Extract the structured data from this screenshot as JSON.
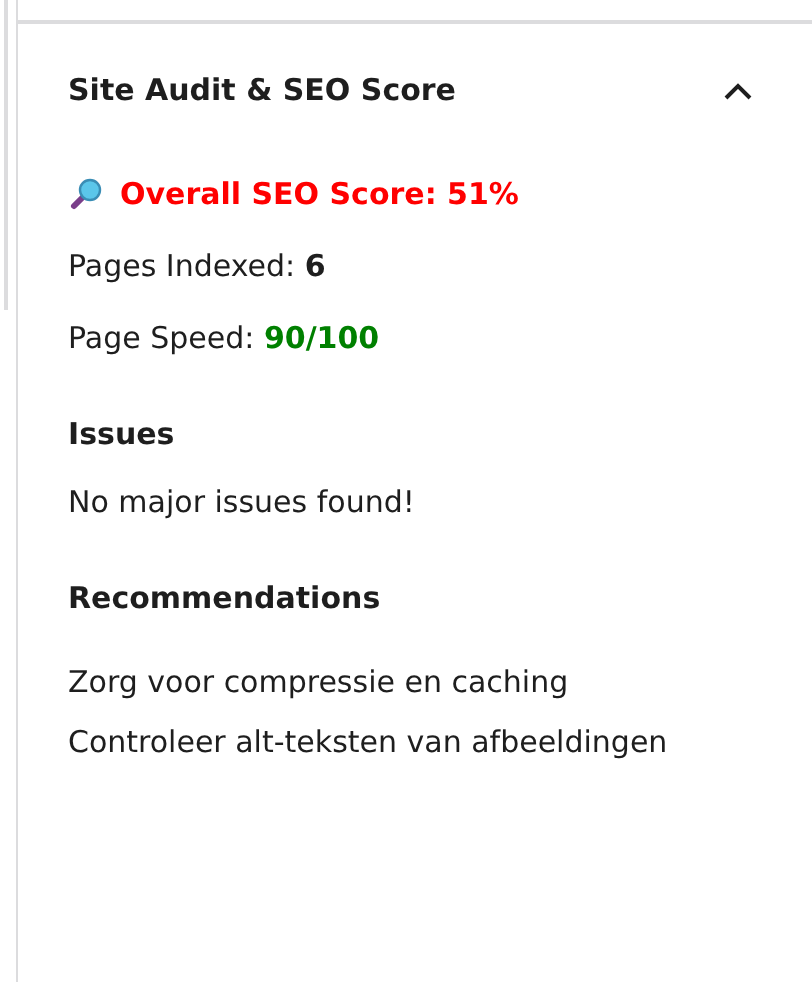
{
  "panel": {
    "title": "Site Audit & SEO Score",
    "expanded": true
  },
  "score": {
    "label": "Overall SEO Score: 51%"
  },
  "stats": [
    {
      "label": "Pages Indexed:",
      "value": "6",
      "kind": "plain"
    },
    {
      "label": "Page Speed:",
      "value": "90/100",
      "kind": "good"
    }
  ],
  "issues": {
    "heading": "Issues",
    "items": [
      "No major issues found!"
    ]
  },
  "recommendations": {
    "heading": "Recommendations",
    "items": [
      "Zorg voor compressie en caching",
      "Controleer alt-teksten van afbeeldingen"
    ]
  }
}
